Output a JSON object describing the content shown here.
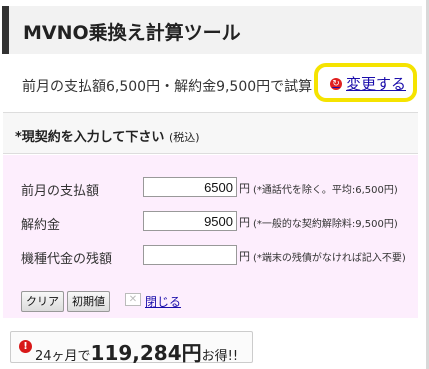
{
  "page": {
    "title": "MVNO乗換え計算ツール",
    "summary": "前月の支払額6,500円・解約金9,500円で試算",
    "change_link": "変更する",
    "change_icon": "circle-icon"
  },
  "form": {
    "heading": "*現契約を入力して下さい",
    "heading_sub": "(税込)",
    "fields": [
      {
        "label": "前月の支払額",
        "value": "6500",
        "unit": "円",
        "note": "(*通話代を除く。平均:6,500円)"
      },
      {
        "label": "解約金",
        "value": "9500",
        "unit": "円",
        "note": "(*一般的な契約解除料:9,500円)"
      },
      {
        "label": "機種代金の残額",
        "value": "",
        "unit": "円",
        "note": "(*端末の残債がなければ記入不要)"
      }
    ],
    "clear_button": "クリア",
    "reset_button": "初期値",
    "close_label": "閉じる"
  },
  "result": {
    "prefix": "24ヶ月で",
    "amount": "119,284円",
    "suffix": "お得!!"
  },
  "colors": {
    "accent_bar": "#333333",
    "highlight": "#f5e300",
    "panel_bg": "#fdeefd",
    "link": "#1a0dab",
    "warn": "#d81818"
  }
}
